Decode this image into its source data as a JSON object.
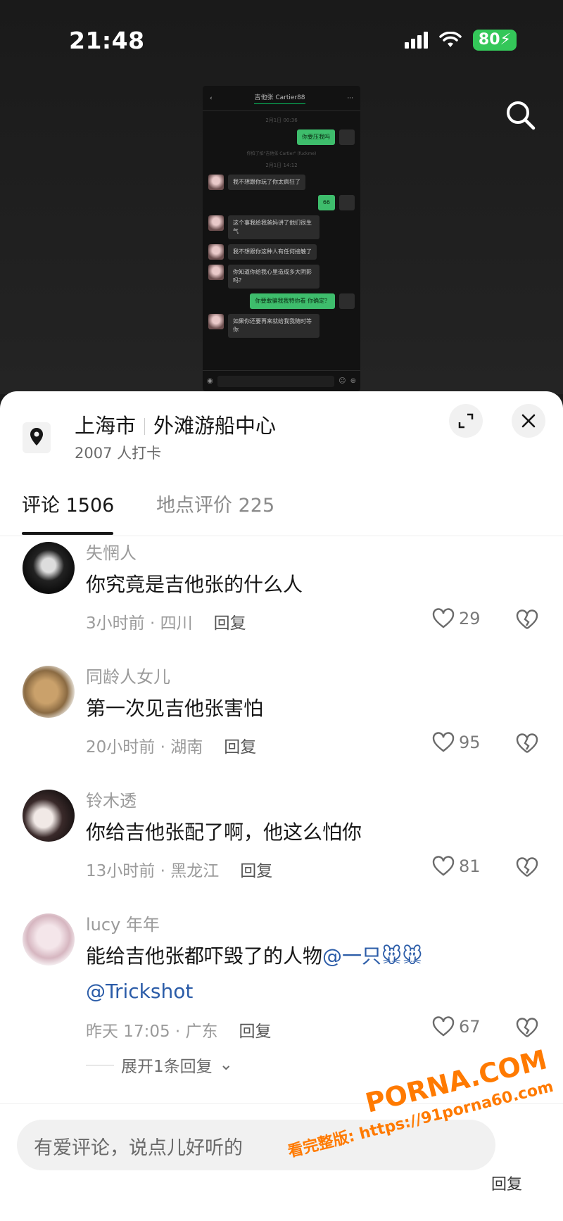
{
  "status": {
    "time": "21:48",
    "battery": "80"
  },
  "chat_preview": {
    "title": "吉他张 Cartier88",
    "time1": "2月1日 00:36",
    "sys_note": "你拍了拍\"吉他张 Cartier\" (fuckme)",
    "time2": "2月1日 14:12",
    "messages": [
      {
        "dir": "out",
        "text": "你要压我吗"
      },
      {
        "dir": "in",
        "text": "我不想跟你玩了你太疯狂了"
      },
      {
        "dir": "out",
        "text": "66"
      },
      {
        "dir": "in",
        "text": "这个事我给我爸妈讲了他们很生气"
      },
      {
        "dir": "in",
        "text": "我不想跟你这种人有任何接触了"
      },
      {
        "dir": "in",
        "text": "你知道你给我心里造成多大阴影吗？"
      },
      {
        "dir": "out",
        "text": "你要敢骗我我特你看 你确定？"
      },
      {
        "dir": "in",
        "text": "如果你还要再来就给我我随时等你"
      }
    ]
  },
  "location": {
    "city": "上海市",
    "place": "外滩游船中心",
    "checkins": "2007 人打卡"
  },
  "tabs": {
    "comments": "评论 1506",
    "reviews": "地点评价 225"
  },
  "comments": [
    {
      "name": "失惘人",
      "text": "你究竟是吉他张的什么人",
      "meta": "3小时前 · 四川",
      "reply": "回复",
      "likes": "29"
    },
    {
      "name": "同龄人女儿",
      "text": "第一次见吉他张害怕",
      "meta": "20小时前 · 湖南",
      "reply": "回复",
      "likes": "95"
    },
    {
      "name": "铃木透",
      "text": "你给吉他张配了啊，他这么怕你",
      "meta": "13小时前 · 黑龙江",
      "reply": "回复",
      "likes": "81"
    },
    {
      "name": "lucy 年年",
      "text": "能给吉他张都吓毁了的人物",
      "mention1": "@一只🐭🐭",
      "mention2": "@Trickshot",
      "meta": "昨天 17:05 · 广东",
      "reply": "回复",
      "likes": "67"
    }
  ],
  "expand_replies": "展开1条回复",
  "input": {
    "placeholder": "有爱评论，说点儿好听的"
  },
  "watermark": {
    "brand": "PORNA.COM",
    "url": "看完整版: https://91porna60.com"
  },
  "input_reply_mini": "回复"
}
